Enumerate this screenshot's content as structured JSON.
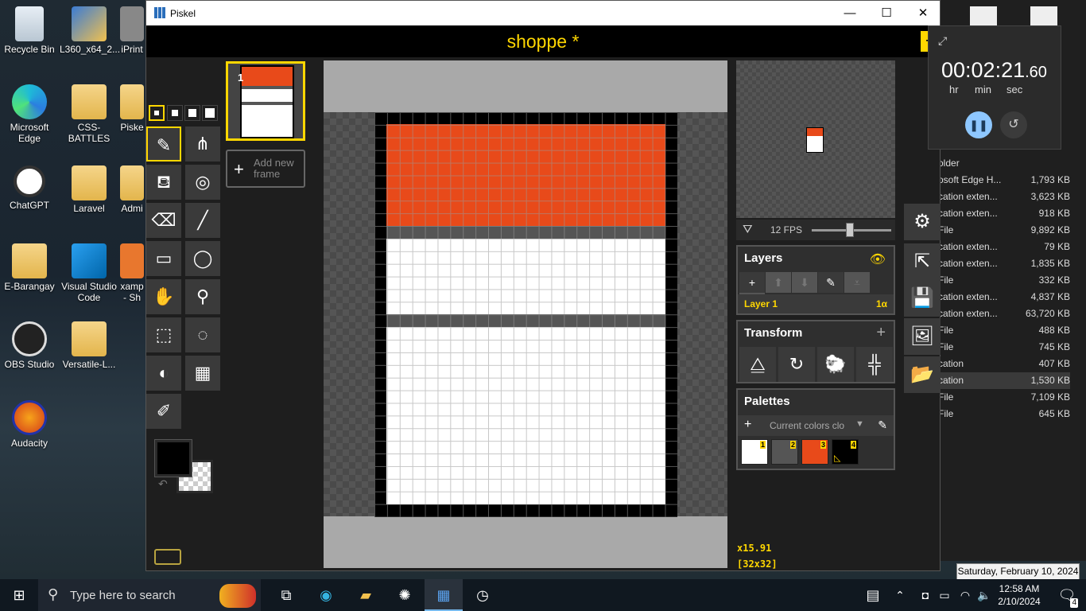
{
  "desktop": {
    "icons": [
      {
        "label": "Recycle Bin"
      },
      {
        "label": "L360_x64_2..."
      },
      {
        "label": "iPrint"
      },
      {
        "label": "Microsoft Edge"
      },
      {
        "label": "CSS-BATTLES"
      },
      {
        "label": "Piske"
      },
      {
        "label": "ChatGPT"
      },
      {
        "label": "Laravel"
      },
      {
        "label": "Admi"
      },
      {
        "label": "E-Barangay"
      },
      {
        "label": "Visual Studio Code"
      },
      {
        "label": "xamp - Sh"
      },
      {
        "label": "OBS Studio"
      },
      {
        "label": "Versatile-L..."
      },
      {
        "label": "Audacity"
      }
    ]
  },
  "explorer": {
    "rows": [
      {
        "name": "older",
        "size": ""
      },
      {
        "name": "osoft Edge H...",
        "size": "1,793 KB"
      },
      {
        "name": "cation exten...",
        "size": "3,623 KB"
      },
      {
        "name": "cation exten...",
        "size": "918 KB"
      },
      {
        "name": "File",
        "size": "9,892 KB"
      },
      {
        "name": "cation exten...",
        "size": "79 KB"
      },
      {
        "name": "cation exten...",
        "size": "1,835 KB"
      },
      {
        "name": "File",
        "size": "332 KB"
      },
      {
        "name": "cation exten...",
        "size": "4,837 KB"
      },
      {
        "name": "cation exten...",
        "size": "63,720 KB"
      },
      {
        "name": "File",
        "size": "488 KB"
      },
      {
        "name": "File",
        "size": "745 KB"
      },
      {
        "name": "cation",
        "size": "407 KB"
      },
      {
        "name": "cation",
        "size": "1,530 KB"
      },
      {
        "name": "File",
        "size": "7,109 KB"
      },
      {
        "name": "File",
        "size": "645 KB"
      }
    ]
  },
  "window": {
    "title": "Piskel",
    "minimize": "—",
    "maximize": "☐",
    "close": "✕"
  },
  "piskel": {
    "sprite_name": "shoppe *",
    "frames": [
      {
        "number": "1"
      }
    ],
    "add_frame": "Add new frame",
    "zoom": "x15.91",
    "size": "[32x32]",
    "fps": "12 FPS",
    "fps_value": 12,
    "layers": {
      "title": "Layers",
      "items": [
        {
          "name": "Layer 1",
          "opacity": "1α"
        }
      ]
    },
    "transform": {
      "title": "Transform"
    },
    "palettes": {
      "title": "Palettes",
      "selected": "Current colors clo",
      "swatches": [
        {
          "num": "1",
          "color": "#ffffff"
        },
        {
          "num": "2",
          "color": "#555555"
        },
        {
          "num": "3",
          "color": "#e84a1a"
        },
        {
          "num": "4",
          "color": "#000000"
        }
      ]
    },
    "primary_color": "#000000",
    "colors": {
      "accent": "#ffd700",
      "orange": "#e84a1a"
    }
  },
  "timer": {
    "time_main": "00:02:21",
    "time_frac": ".60",
    "labels": [
      "hr",
      "min",
      "sec"
    ]
  },
  "taskbar": {
    "search_placeholder": "Type here to search",
    "time": "12:58 AM",
    "date": "2/10/2024",
    "notifications": "4",
    "tooltip": "Saturday, February 10, 2024"
  }
}
